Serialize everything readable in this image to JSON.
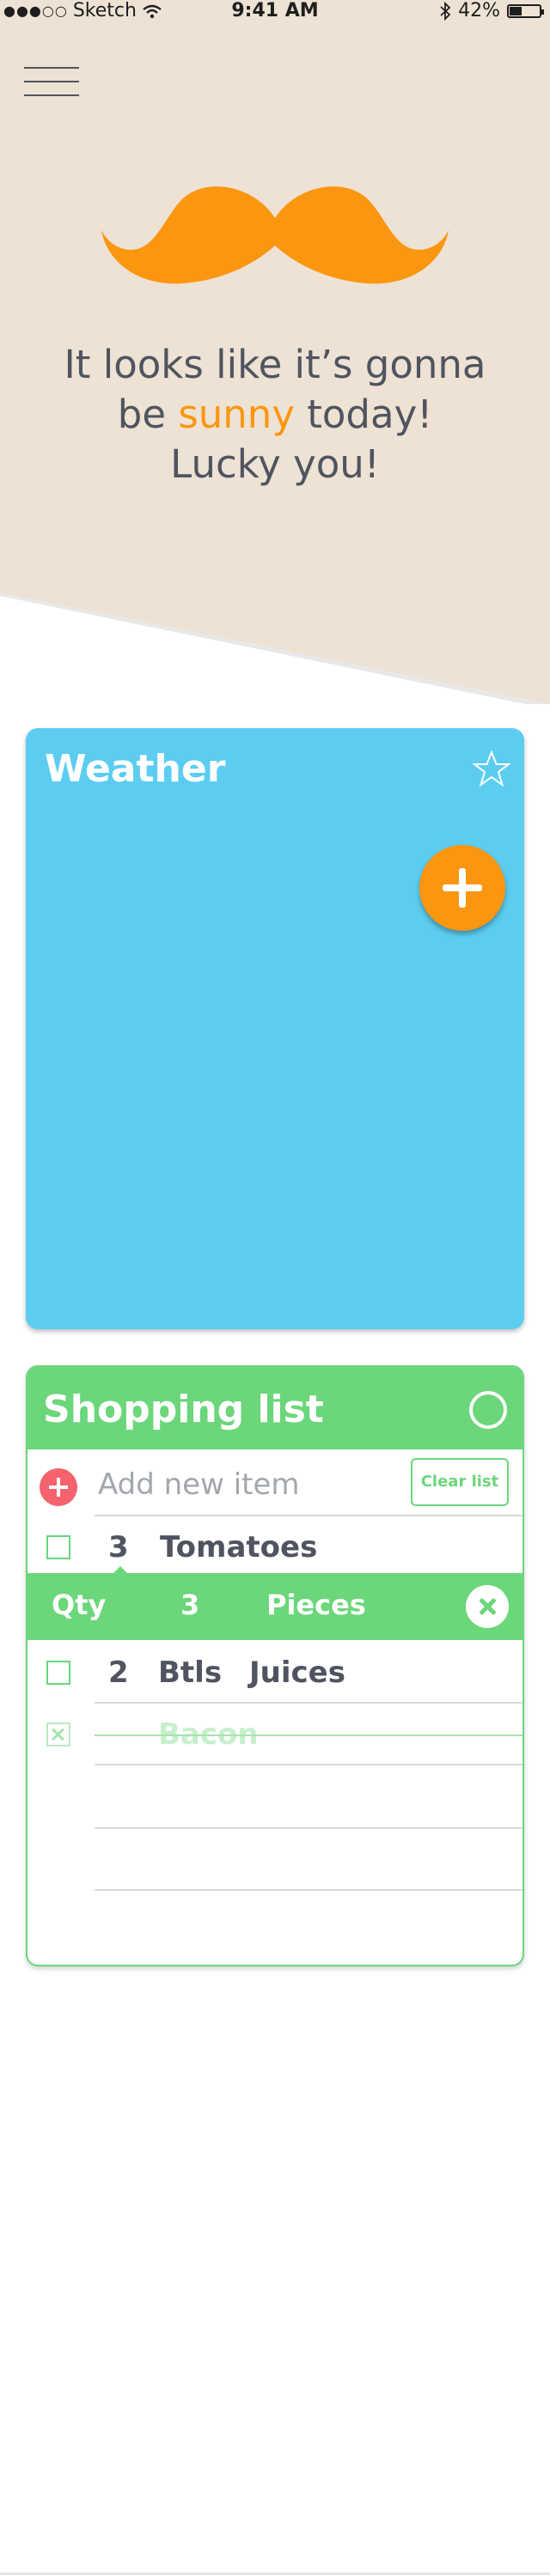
{
  "status_bar": {
    "carrier": "Sketch",
    "time": "9:41 AM",
    "battery": "42%",
    "battery_level": 0.42,
    "signal_icon": "signal-dots-icon",
    "wifi_icon": "wifi-icon",
    "bluetooth_icon": "bluetooth-icon"
  },
  "hero": {
    "background_color": "#ede2d3",
    "headline_line1": "It looks like it’s gonna",
    "headline_pre": "be ",
    "headline_highlight": "sunny",
    "headline_post": " today!",
    "headline_line3": "Lucky you!",
    "highlight_color": "#fb9611",
    "icon": "mustache-icon"
  },
  "weather_card": {
    "title": "Weather",
    "color": "#5ccdf1",
    "favorite_icon": "star-outline-icon",
    "fab_icon": "plus-icon",
    "fab_color": "#fb9611"
  },
  "shopping_card": {
    "title": "Shopping list",
    "accent_color": "#6bd67a",
    "add_placeholder": "Add new item",
    "clear_label": "Clear list",
    "items": [
      {
        "qty": "3",
        "unit": "",
        "name": "Tomatoes",
        "checked": false
      },
      {
        "qty": "2",
        "unit": "Btls",
        "name": "Juices",
        "checked": false
      },
      {
        "qty": "",
        "unit": "",
        "name": "Bacon",
        "checked": true
      }
    ],
    "qty_editor": {
      "label": "Qty",
      "value": "3",
      "unit": "Pieces"
    }
  }
}
